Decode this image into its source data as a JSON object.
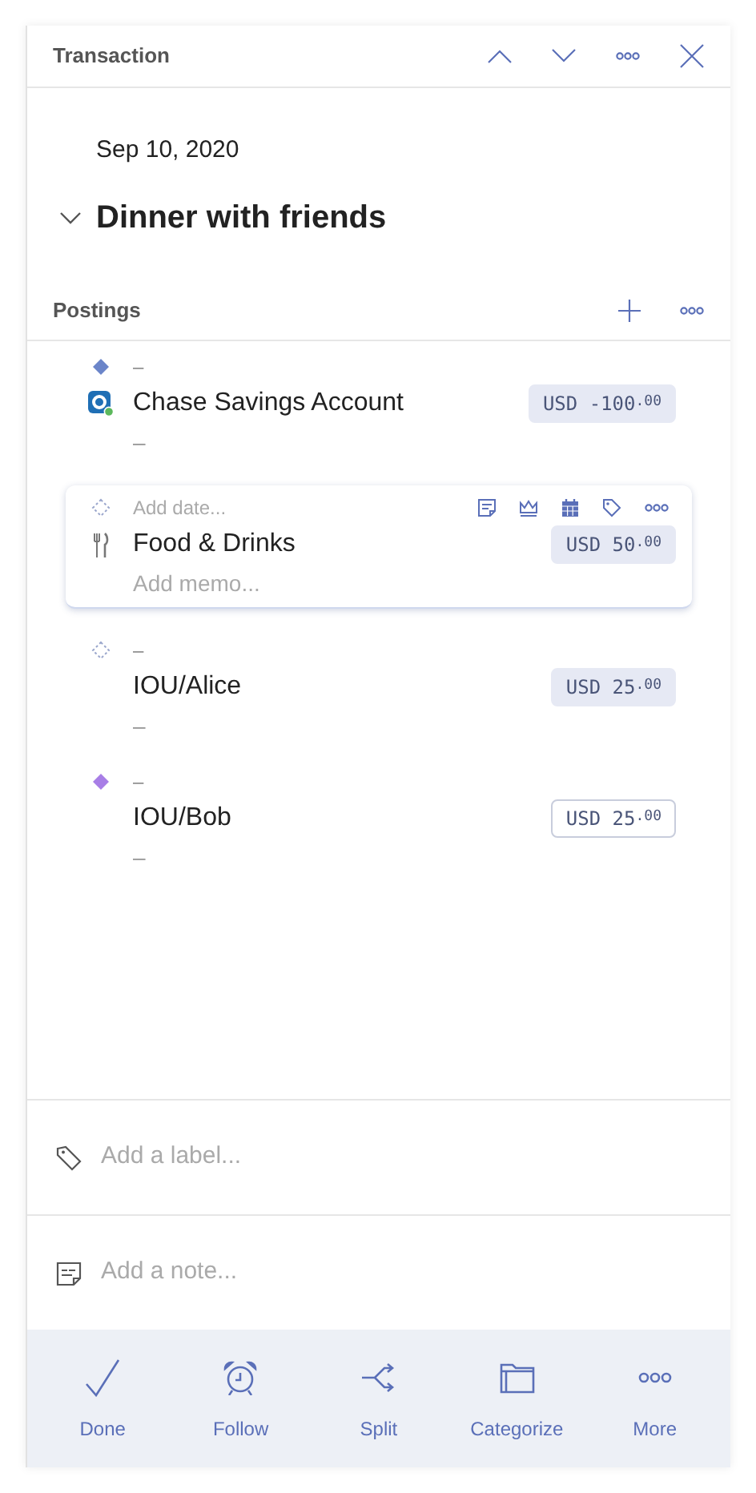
{
  "header": {
    "title": "Transaction"
  },
  "date": "Sep 10, 2020",
  "title": {
    "text": "Dinner with friends",
    "expanded": true
  },
  "postings_header": {
    "title": "Postings"
  },
  "postings": [
    {
      "marker": {
        "kind": "filled",
        "color": "#6b85c9"
      },
      "date": "–",
      "account_icon": {
        "kind": "bank"
      },
      "account": "Chase Savings Account",
      "memo": "–",
      "amount": "USD -100",
      "cents": ".00",
      "filled": true,
      "selected": false
    },
    {
      "marker": {
        "kind": "dashed"
      },
      "date_placeholder": "Add date...",
      "account_icon": {
        "kind": "utensils"
      },
      "account": "Food & Drinks",
      "memo_placeholder": "Add memo...",
      "amount": "USD 50",
      "cents": ".00",
      "filled": true,
      "selected": true
    },
    {
      "marker": {
        "kind": "dashed"
      },
      "date": "–",
      "account": "IOU/Alice",
      "memo": "–",
      "amount": "USD 25",
      "cents": ".00",
      "filled": true,
      "selected": false
    },
    {
      "marker": {
        "kind": "filled",
        "color": "#a87ee6"
      },
      "date": "–",
      "account": "IOU/Bob",
      "memo": "–",
      "amount": "USD 25",
      "cents": ".00",
      "filled": false,
      "selected": false
    }
  ],
  "label_field": {
    "placeholder": "Add a label..."
  },
  "note_field": {
    "placeholder": "Add a note..."
  },
  "actions": [
    {
      "kind": "done",
      "label": "Done"
    },
    {
      "kind": "follow",
      "label": "Follow"
    },
    {
      "kind": "split",
      "label": "Split"
    },
    {
      "kind": "categorize",
      "label": "Categorize"
    },
    {
      "kind": "more",
      "label": "More"
    }
  ]
}
